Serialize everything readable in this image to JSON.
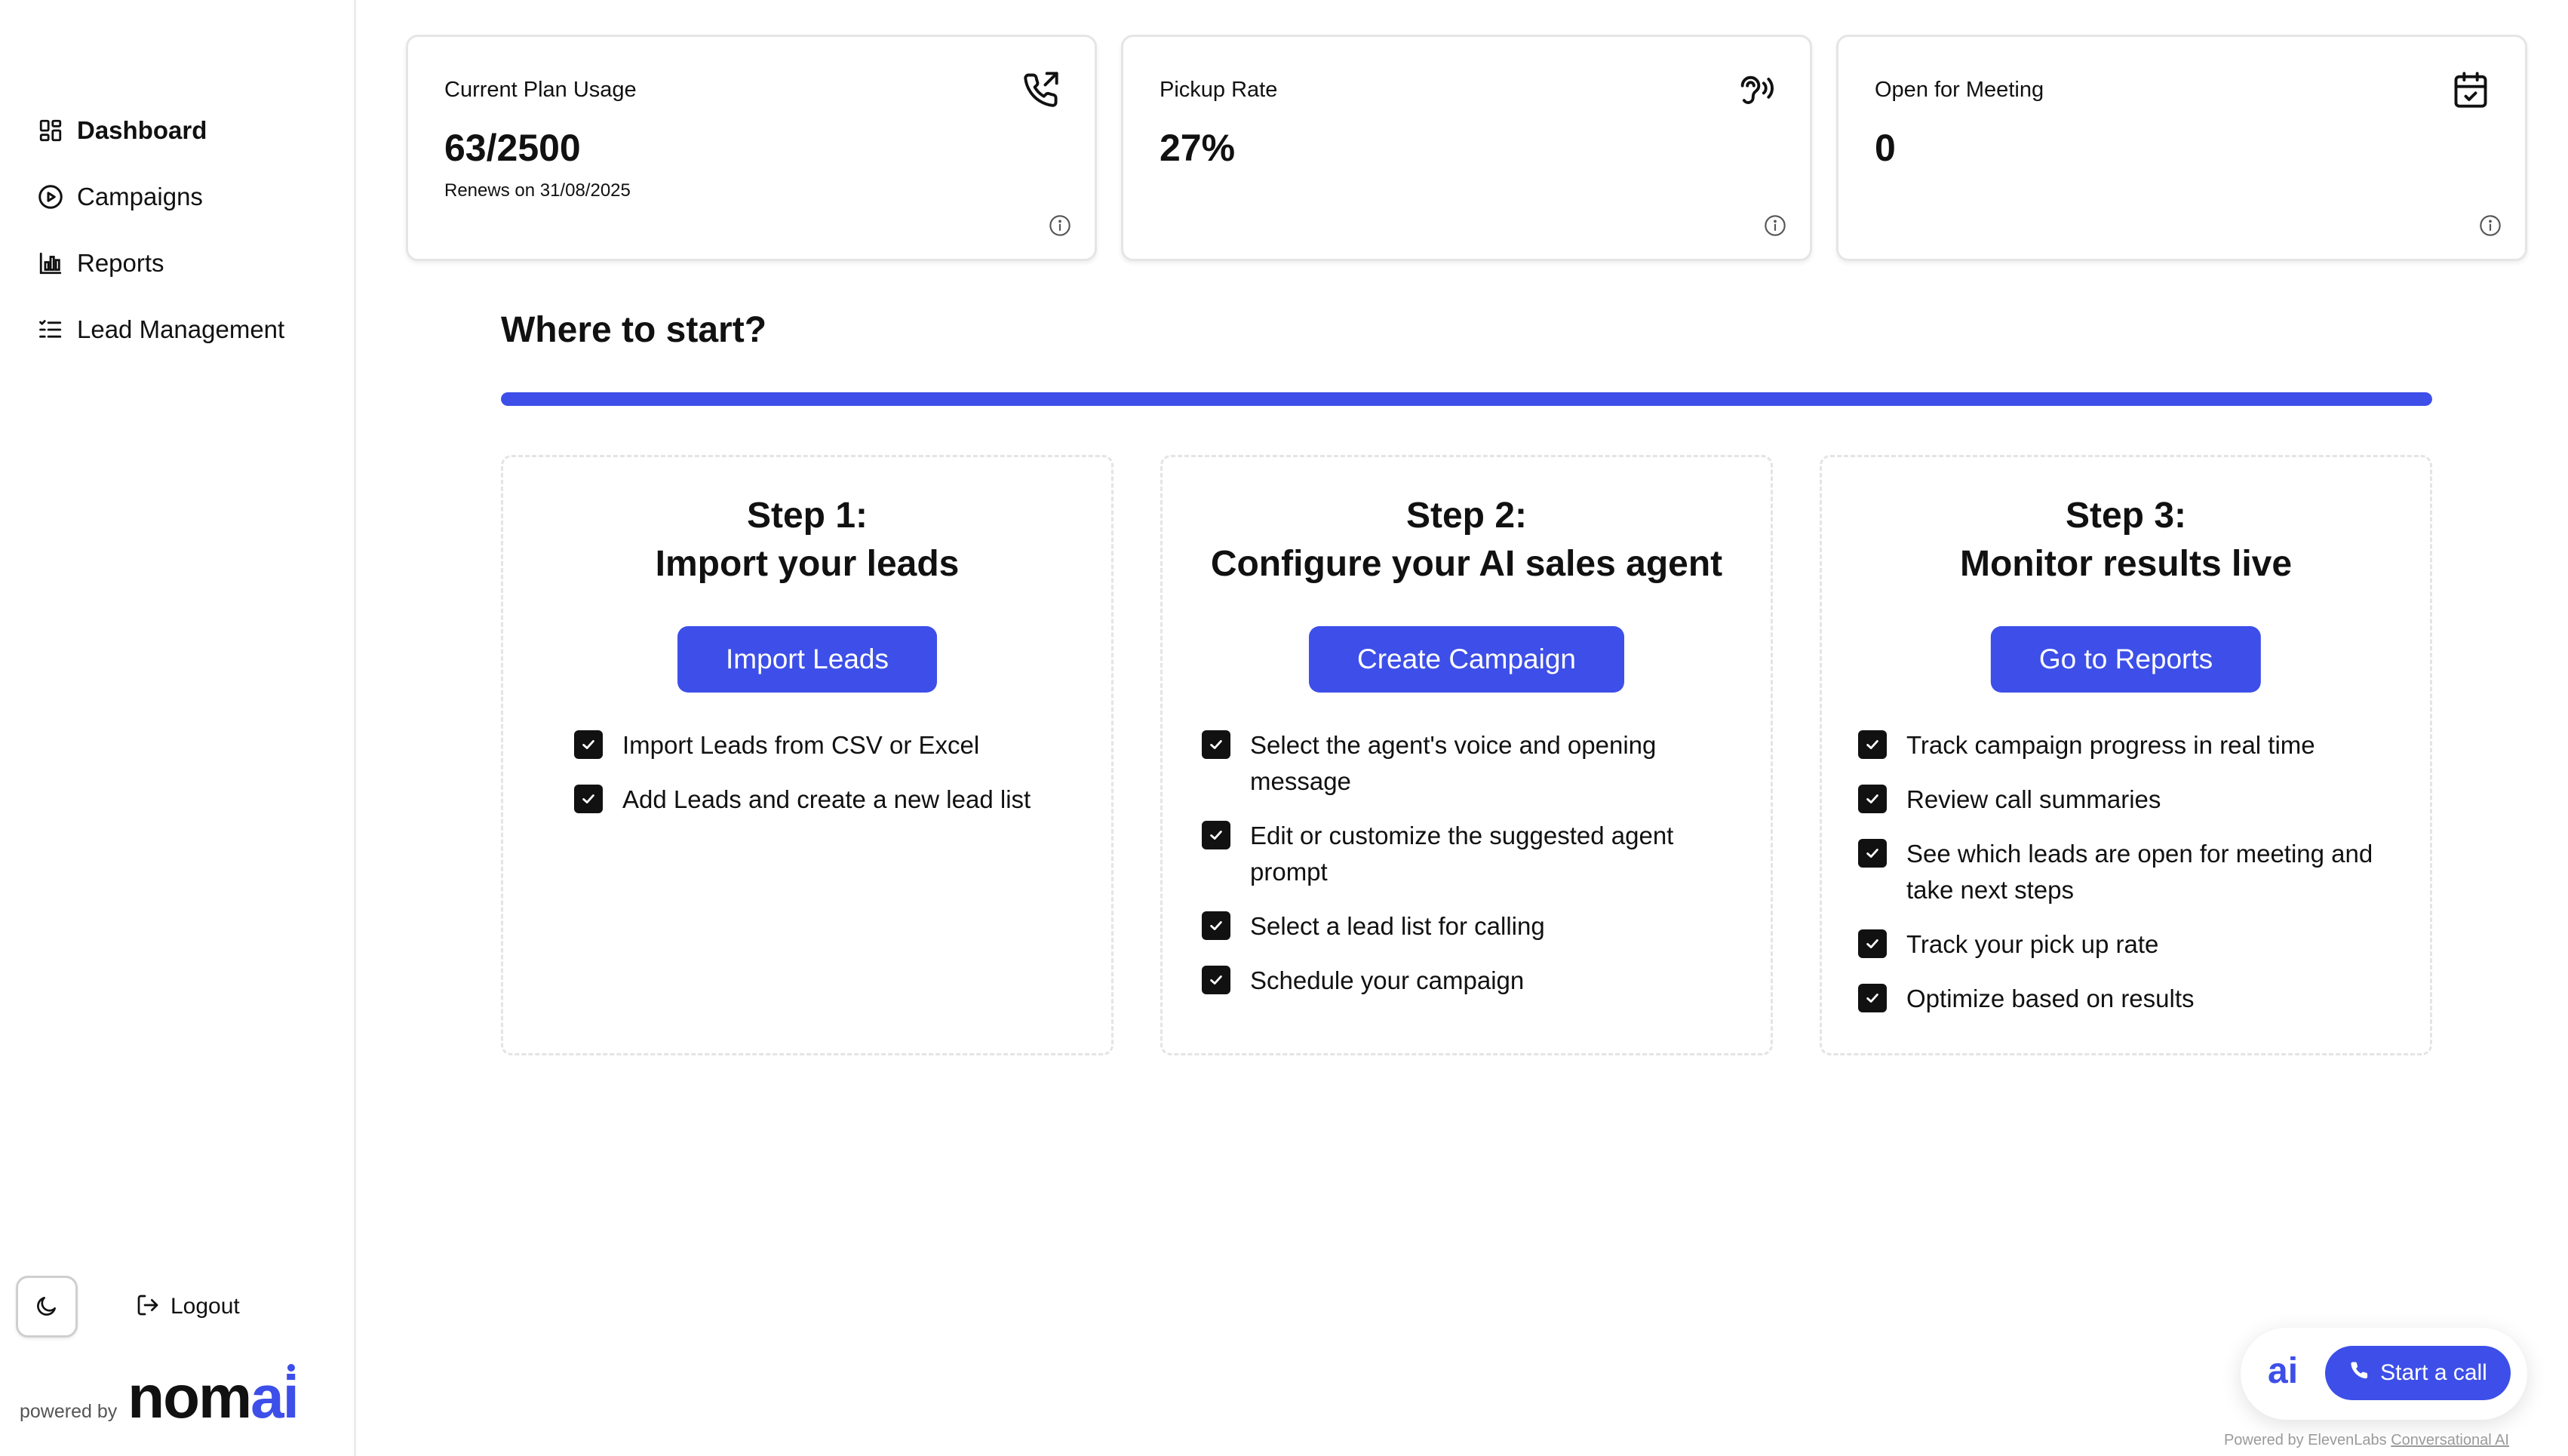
{
  "sidebar": {
    "items": [
      {
        "label": "Dashboard",
        "icon": "dashboard-icon",
        "active": true
      },
      {
        "label": "Campaigns",
        "icon": "play-circle-icon",
        "active": false
      },
      {
        "label": "Reports",
        "icon": "bar-chart-icon",
        "active": false
      },
      {
        "label": "Lead Management",
        "icon": "list-check-icon",
        "active": false
      }
    ],
    "theme_toggle_icon": "moon-icon",
    "logout_label": "Logout",
    "powered_by_label": "powered by",
    "logo": {
      "prefix": "nom",
      "suffix": "ai"
    }
  },
  "stats": [
    {
      "title": "Current Plan Usage",
      "value": "63/2500",
      "sub": "Renews on 31/08/2025",
      "icon": "phone-outgoing-icon"
    },
    {
      "title": "Pickup Rate",
      "value": "27%",
      "sub": "",
      "icon": "ear-sound-icon"
    },
    {
      "title": "Open for Meeting",
      "value": "0",
      "sub": "",
      "icon": "calendar-check-icon"
    }
  ],
  "where_to_start": {
    "heading": "Where to start?",
    "progress_fraction": 1.0,
    "steps": [
      {
        "title_line1": "Step 1:",
        "title_line2": "Import your leads",
        "button": "Import Leads",
        "items": [
          "Import Leads from CSV or Excel",
          "Add Leads and create a new lead list"
        ]
      },
      {
        "title_line1": "Step 2:",
        "title_line2": "Configure your AI sales agent",
        "button": "Create Campaign",
        "items": [
          "Select the agent's voice and opening message",
          "Edit or customize the suggested agent prompt",
          "Select a lead list for calling",
          "Schedule your campaign"
        ]
      },
      {
        "title_line1": "Step 3:",
        "title_line2": "Monitor results live",
        "button": "Go to Reports",
        "items": [
          "Track campaign progress in real time",
          "Review call summaries",
          "See which leads are open for meeting and take next steps",
          "Track your pick up rate",
          "Optimize based on results"
        ]
      }
    ]
  },
  "widget": {
    "logo_text": "ai",
    "call_label": "Start a call",
    "footer_prefix": "Powered by ElevenLabs",
    "footer_link": "Conversational AI"
  },
  "colors": {
    "accent": "#3d4fe8",
    "text": "#111111",
    "border": "#e5e5e5"
  }
}
